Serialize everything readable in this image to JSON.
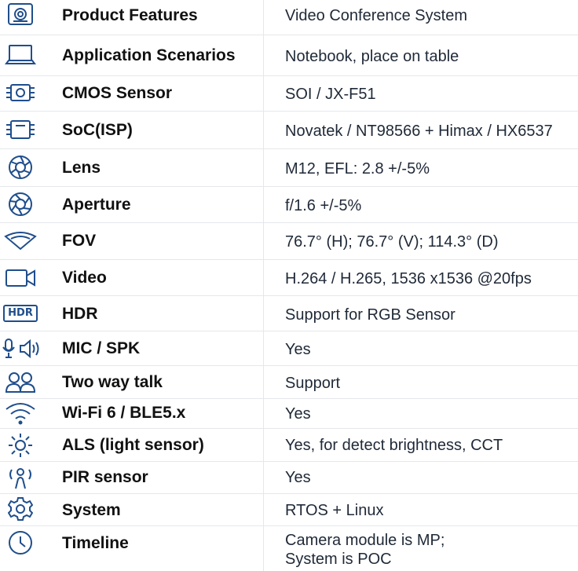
{
  "colors": {
    "icon": "#1f4e8c",
    "text": "#111827",
    "divider": "#e5e7eb"
  },
  "rows": [
    {
      "icon": "camera-module-icon",
      "label": "Product Features",
      "value": "Video Conference System"
    },
    {
      "icon": "laptop-icon",
      "label": "Application Scenarios",
      "value": "Notebook, place on table"
    },
    {
      "icon": "sensor-chip-icon",
      "label": "CMOS Sensor",
      "value": "SOI / JX-F51"
    },
    {
      "icon": "soc-chip-icon",
      "label": "SoC(ISP)",
      "value": "Novatek / NT98566  +  Himax / HX6537"
    },
    {
      "icon": "lens-aperture-icon",
      "label": "Lens",
      "value": "M12, EFL: 2.8 +/-5%"
    },
    {
      "icon": "aperture-icon",
      "label": "Aperture",
      "value": "f/1.6 +/-5%"
    },
    {
      "icon": "fov-icon",
      "label": "FOV",
      "value": "76.7° (H); 76.7° (V); 114.3° (D)"
    },
    {
      "icon": "video-camera-icon",
      "label": "Video",
      "value": "H.264 / H.265, 1536 x1536 @20fps"
    },
    {
      "icon": "hdr-icon",
      "icon_text": "HDR",
      "label": "HDR",
      "value": "Support for RGB Sensor"
    },
    {
      "icon": "mic-speaker-icon",
      "label": "MIC / SPK",
      "value": "Yes"
    },
    {
      "icon": "two-people-icon",
      "label": "Two way talk",
      "value": "Support"
    },
    {
      "icon": "wifi-icon",
      "label": "Wi-Fi 6 / BLE5.x",
      "value": "Yes"
    },
    {
      "icon": "light-sun-icon",
      "label": "ALS (light sensor)",
      "value": "Yes, for detect brightness, CCT"
    },
    {
      "icon": "motion-person-icon",
      "label": "PIR sensor",
      "value": "Yes"
    },
    {
      "icon": "gear-icon",
      "label": "System",
      "value": "RTOS + Linux"
    },
    {
      "icon": "clock-icon",
      "label": "Timeline",
      "value_lines": [
        "Camera module is MP;",
        "System is POC"
      ]
    }
  ]
}
